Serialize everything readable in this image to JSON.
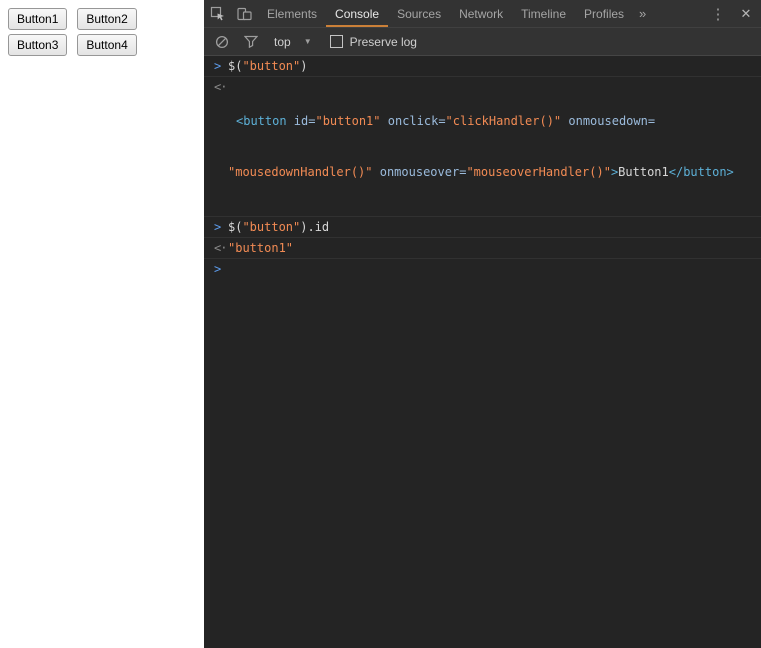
{
  "page": {
    "buttons": [
      {
        "label": "Button1"
      },
      {
        "label": "Button2"
      },
      {
        "label": "Button3"
      },
      {
        "label": "Button4"
      }
    ]
  },
  "devtools": {
    "tabs": [
      {
        "label": "Elements"
      },
      {
        "label": "Console"
      },
      {
        "label": "Sources"
      },
      {
        "label": "Network"
      },
      {
        "label": "Timeline"
      },
      {
        "label": "Profiles"
      }
    ],
    "more_tabs_icon": "»",
    "menu_icon": "⋮",
    "close_icon": "✕",
    "toolbar": {
      "context_label": "top",
      "context_caret_icon": "▼",
      "preserve_log_label": "Preserve log"
    },
    "console": {
      "prompt_symbol": ">",
      "result_symbol": "<·",
      "entry1_tokens": [
        "$(",
        "\"button\"",
        ")"
      ],
      "entry2_line1": [
        "<button ",
        "id=",
        "\"button1\"",
        " ",
        "onclick=",
        "\"clickHandler()\"",
        " ",
        "onmousedown="
      ],
      "entry2_line2": [
        "\"mousedownHandler()\"",
        " ",
        "onmouseover=",
        "\"mouseoverHandler()\"",
        ">",
        "Button1",
        "</button>"
      ],
      "entry3_tokens": [
        "$(",
        "\"button\"",
        ").id"
      ],
      "entry4_tokens": [
        "\"button1\""
      ]
    }
  },
  "colors": {
    "devtools-bg": "#242424",
    "toolbar-bg": "#333333",
    "tab-active-underline": "#cb8038",
    "prompt-blue": "#5d9cec",
    "string-orange": "#f28b54",
    "tag-blue": "#5db0d7",
    "attr-blue": "#9bbbdc",
    "text-light": "#d8d8d8"
  }
}
